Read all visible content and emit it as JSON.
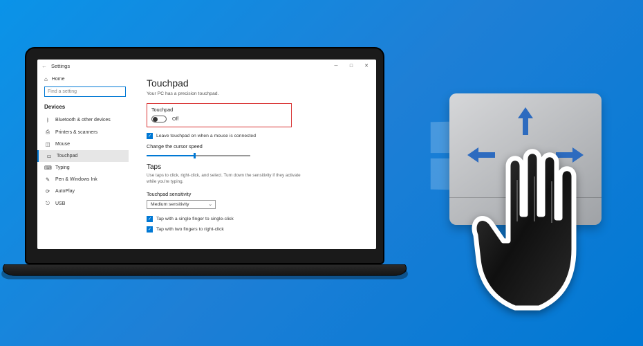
{
  "window": {
    "title": "Settings"
  },
  "sidebar": {
    "home": "Home",
    "search_placeholder": "Find a setting",
    "category": "Devices",
    "items": [
      {
        "icon": "bluetooth-icon",
        "glyph": "ᛒ",
        "label": "Bluetooth & other devices"
      },
      {
        "icon": "printer-icon",
        "glyph": "⎙",
        "label": "Printers & scanners"
      },
      {
        "icon": "mouse-icon",
        "glyph": "◫",
        "label": "Mouse"
      },
      {
        "icon": "touchpad-icon",
        "glyph": "▭",
        "label": "Touchpad"
      },
      {
        "icon": "typing-icon",
        "glyph": "⌨",
        "label": "Typing"
      },
      {
        "icon": "pen-icon",
        "glyph": "✎",
        "label": "Pen & Windows Ink"
      },
      {
        "icon": "autoplay-icon",
        "glyph": "⟳",
        "label": "AutoPlay"
      },
      {
        "icon": "usb-icon",
        "glyph": "⎋",
        "label": "USB"
      }
    ]
  },
  "main": {
    "title": "Touchpad",
    "subtitle": "Your PC has a precision touchpad.",
    "toggle_section_label": "Touchpad",
    "toggle_state": "Off",
    "leave_on_label": "Leave touchpad on when a mouse is connected",
    "cursor_speed_label": "Change the cursor speed",
    "taps_heading": "Taps",
    "taps_help": "Use taps to click, right-click, and select. Turn down the sensitivity if they activate while you're typing.",
    "sensitivity_label": "Touchpad sensitivity",
    "sensitivity_value": "Medium sensitivity",
    "tap_single_label": "Tap with a single finger to single-click",
    "tap_two_label": "Tap with two fingers to right-click"
  },
  "colors": {
    "accent": "#0078d4",
    "highlight": "#d83131"
  }
}
